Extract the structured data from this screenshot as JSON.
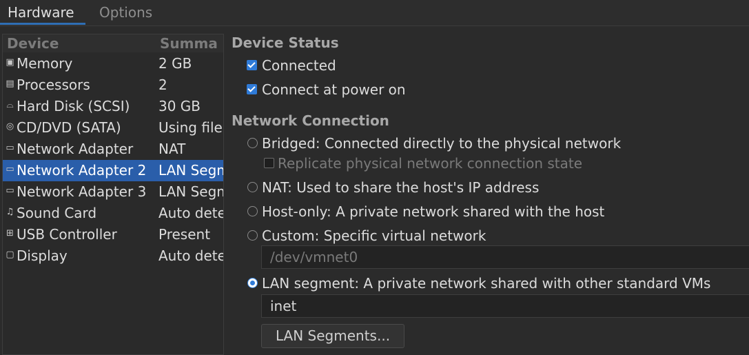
{
  "tabs": {
    "hardware": "Hardware",
    "options": "Options"
  },
  "device_list": {
    "columns": {
      "device": "Device",
      "summary": "Summa"
    },
    "rows": [
      {
        "icon": "memory-icon",
        "glyph": "▣",
        "name": "Memory",
        "summary": "2 GB"
      },
      {
        "icon": "processor-icon",
        "glyph": "▤",
        "name": "Processors",
        "summary": "2"
      },
      {
        "icon": "hard-disk-icon",
        "glyph": "⌓",
        "name": "Hard Disk (SCSI)",
        "summary": "30 GB"
      },
      {
        "icon": "cd-dvd-icon",
        "glyph": "◎",
        "name": "CD/DVD (SATA)",
        "summary": "Using file"
      },
      {
        "icon": "network-adapter-icon",
        "glyph": "▭",
        "name": "Network Adapter",
        "summary": "NAT"
      },
      {
        "icon": "network-adapter-icon",
        "glyph": "▭",
        "name": "Network Adapter 2",
        "summary": "LAN Segment"
      },
      {
        "icon": "network-adapter-icon",
        "glyph": "▭",
        "name": "Network Adapter 3",
        "summary": "LAN Segment"
      },
      {
        "icon": "sound-card-icon",
        "glyph": "♫",
        "name": "Sound Card",
        "summary": "Auto detect"
      },
      {
        "icon": "usb-controller-icon",
        "glyph": "⊞",
        "name": "USB Controller",
        "summary": "Present"
      },
      {
        "icon": "display-icon",
        "glyph": "▢",
        "name": "Display",
        "summary": "Auto detect"
      }
    ],
    "selected_index": 5
  },
  "device_status": {
    "title": "Device Status",
    "connected": "Connected",
    "connect_at_power_on": "Connect at power on"
  },
  "network_connection": {
    "title": "Network Connection",
    "bridged": "Bridged: Connected directly to the physical network",
    "replicate": "Replicate physical network connection state",
    "nat": "NAT: Used to share the host's IP address",
    "host_only": "Host-only: A private network shared with the host",
    "custom": "Custom: Specific virtual network",
    "custom_value": "/dev/vmnet0",
    "lan_segment": "LAN segment: A private network shared with other standard VMs",
    "lan_segment_value": "inet",
    "lan_segments_button": "LAN Segments..."
  }
}
